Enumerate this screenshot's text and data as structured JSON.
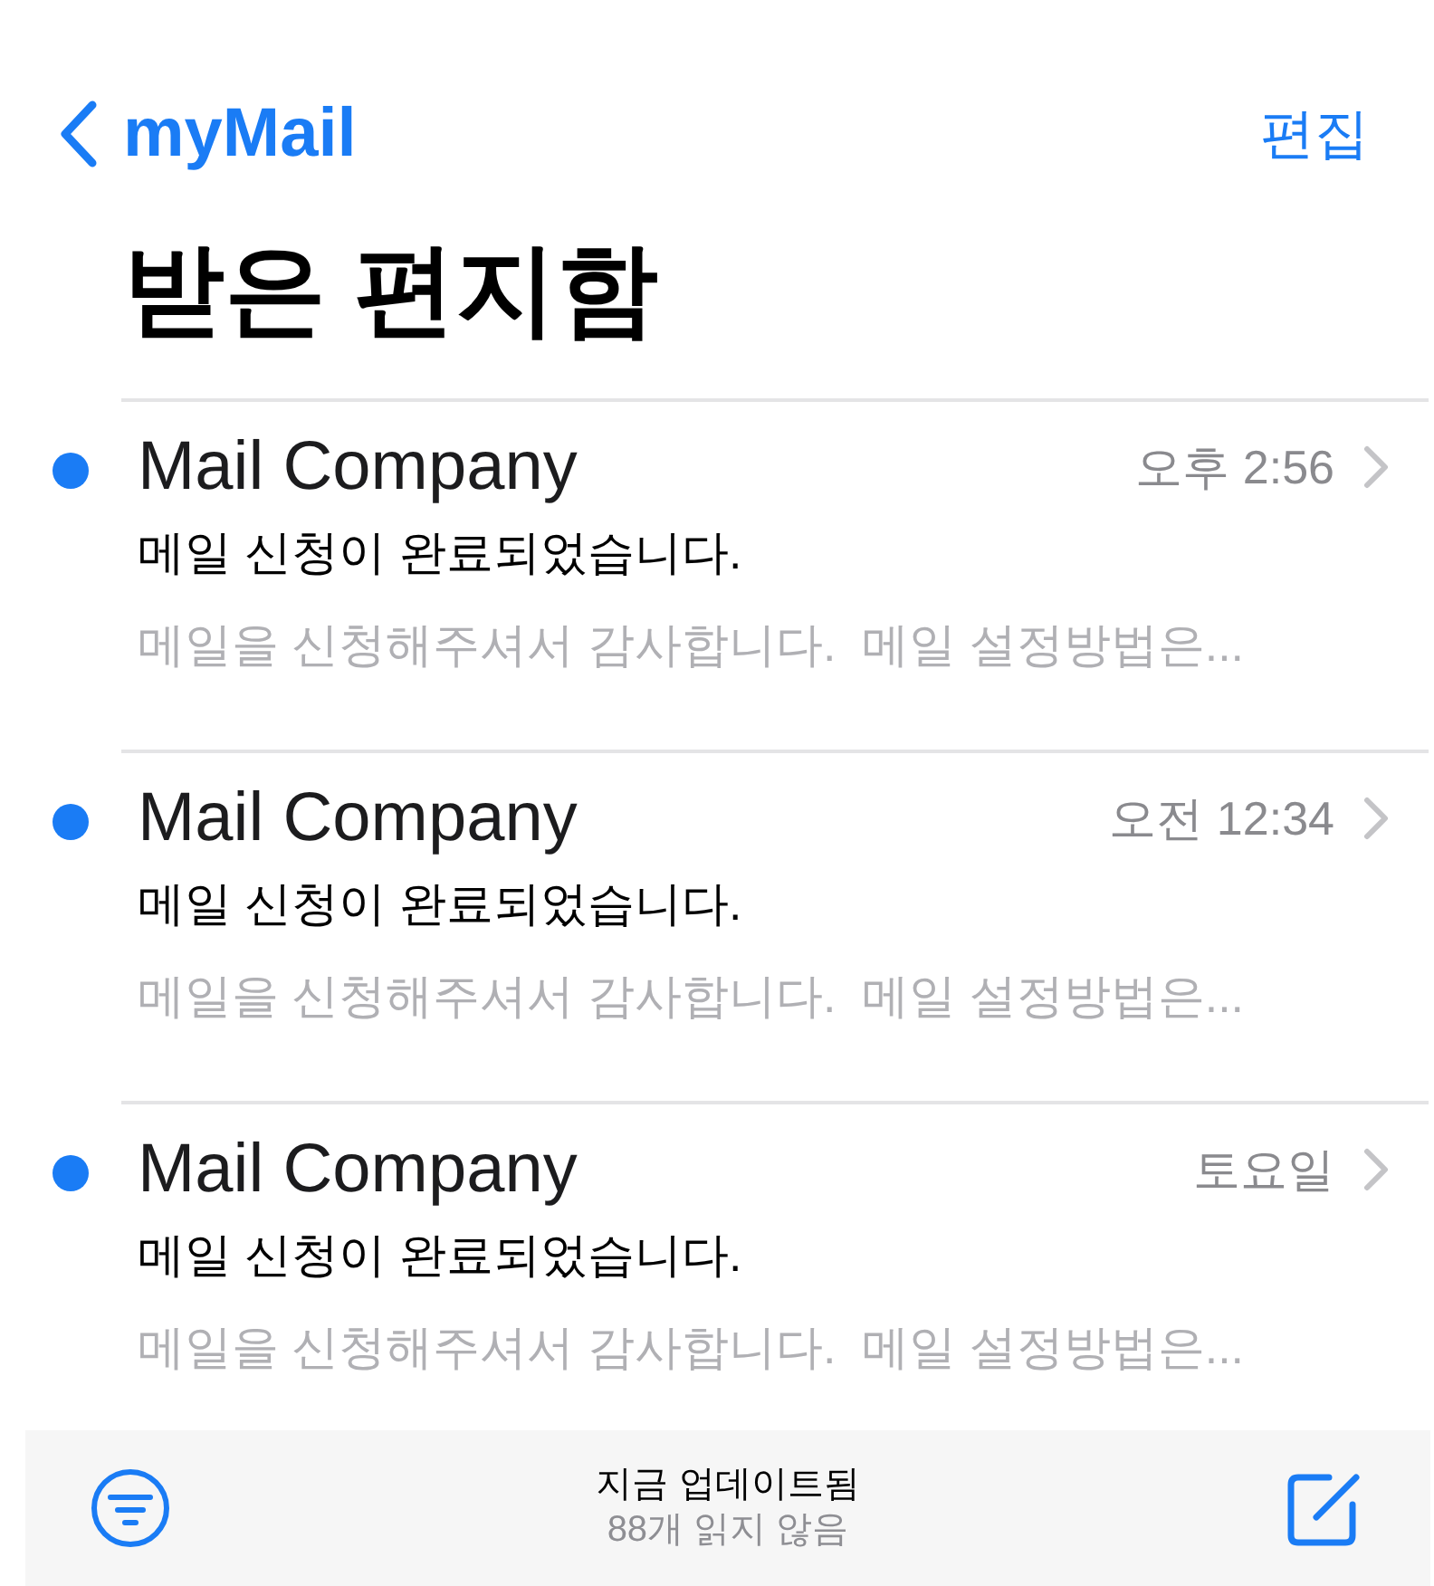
{
  "nav": {
    "back_label": "myMail",
    "edit": "편집"
  },
  "title": "받은 편지함",
  "messages": [
    {
      "sender": "Mail Company",
      "time": "오후 2:56",
      "subject": "메일 신청이 완료되었습니다.",
      "preview": "메일을 신청해주셔서 감사합니다.  메일 설정방법은...",
      "unread": true
    },
    {
      "sender": "Mail Company",
      "time": "오전 12:34",
      "subject": "메일 신청이 완료되었습니다.",
      "preview": "메일을 신청해주셔서 감사합니다.  메일 설정방법은...",
      "unread": true
    },
    {
      "sender": "Mail Company",
      "time": "토요일",
      "subject": "메일 신청이 완료되었습니다.",
      "preview": "메일을 신청해주셔서 감사합니다.  메일 설정방법은...",
      "unread": true
    }
  ],
  "toolbar": {
    "status": "지금 업데이트됨",
    "unread_count": "88개 읽지 않음"
  }
}
